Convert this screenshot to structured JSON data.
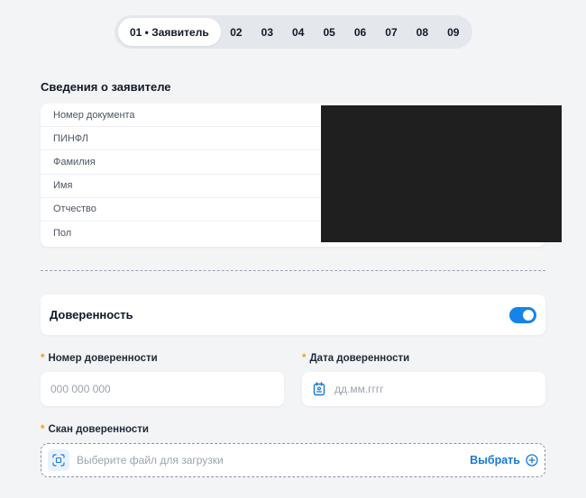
{
  "stepper": {
    "active_label": "01 • Заявитель",
    "steps": [
      "02",
      "03",
      "04",
      "05",
      "06",
      "07",
      "08",
      "09"
    ]
  },
  "applicant_section": {
    "title": "Сведения о заявителе",
    "rows": [
      "Номер документа",
      "ПИНФЛ",
      "Фамилия",
      "Имя",
      "Отчество",
      "Пол"
    ]
  },
  "proxy_toggle": {
    "label": "Доверенность",
    "enabled": true
  },
  "proxy_number": {
    "required_mark": "*",
    "label": "Номер доверенности",
    "placeholder": "000 000 000",
    "value": ""
  },
  "proxy_date": {
    "required_mark": "*",
    "label": "Дата доверенности",
    "placeholder": "дд.мм.гггг",
    "value": ""
  },
  "proxy_scan": {
    "required_mark": "*",
    "label": "Скан доверенности",
    "placeholder": "Выберите файл для загрузки",
    "choose_label": "Выбрать"
  },
  "colors": {
    "accent": "#1583e8",
    "required": "#f59e0b",
    "background": "#f3f4f6"
  },
  "icons": [
    "calendar-icon",
    "upload-scan-icon",
    "plus-circle-icon"
  ]
}
